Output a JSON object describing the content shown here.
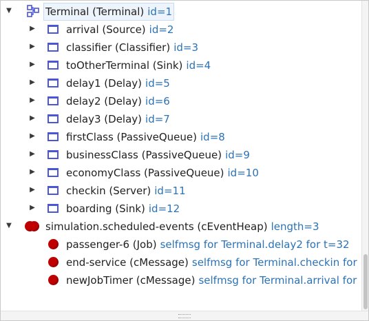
{
  "tree": {
    "root": {
      "name": "Terminal (Terminal)",
      "info": "id=1"
    },
    "modules": [
      {
        "name": "arrival (Source)",
        "info": "id=2"
      },
      {
        "name": "classifier (Classifier)",
        "info": "id=3"
      },
      {
        "name": "toOtherTerminal (Sink)",
        "info": "id=4"
      },
      {
        "name": "delay1 (Delay)",
        "info": "id=5"
      },
      {
        "name": "delay2 (Delay)",
        "info": "id=6"
      },
      {
        "name": "delay3 (Delay)",
        "info": "id=7"
      },
      {
        "name": "firstClass (PassiveQueue)",
        "info": "id=8"
      },
      {
        "name": "businessClass (PassiveQueue)",
        "info": "id=9"
      },
      {
        "name": "economyClass (PassiveQueue)",
        "info": "id=10"
      },
      {
        "name": "checkin (Server)",
        "info": "id=11"
      },
      {
        "name": "boarding (Sink)",
        "info": "id=12"
      }
    ],
    "events_root": {
      "name": "simulation.scheduled-events (cEventHeap)",
      "info": "length=3"
    },
    "events": [
      {
        "name": "passenger-6 (Job)",
        "info": "selfmsg for Terminal.delay2 for t=32"
      },
      {
        "name": "end-service (cMessage)",
        "info": "selfmsg for Terminal.checkin for"
      },
      {
        "name": "newJobTimer (cMessage)",
        "info": "selfmsg for Terminal.arrival for"
      }
    ]
  },
  "icons": {
    "root": "network-compound-module-icon",
    "module": "simple-module-icon",
    "event_heap": "event-heap-icon",
    "event": "message-icon"
  },
  "colors": {
    "info_text": "#2b72b6",
    "module_icon": "#4a55d8",
    "message_dot": "#c00000",
    "selection": "#eef4fb"
  }
}
